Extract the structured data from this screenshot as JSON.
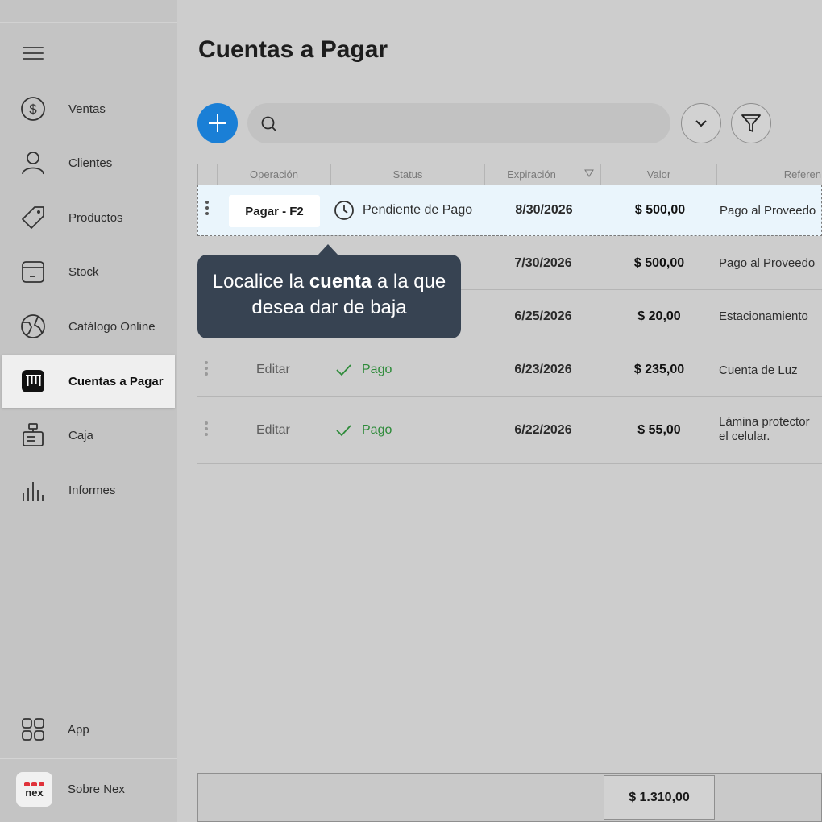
{
  "sidebar": {
    "items": [
      {
        "label": "Ventas",
        "icon": "dollar-icon"
      },
      {
        "label": "Clientes",
        "icon": "user-icon"
      },
      {
        "label": "Productos",
        "icon": "tag-icon"
      },
      {
        "label": "Stock",
        "icon": "box-icon"
      },
      {
        "label": "Catálogo Online",
        "icon": "globe-icon"
      },
      {
        "label": "Cuentas a Pagar",
        "icon": "bills-icon",
        "active": true
      },
      {
        "label": "Caja",
        "icon": "cash-register-icon"
      },
      {
        "label": "Informes",
        "icon": "bar-chart-icon"
      }
    ],
    "app_label": "App",
    "about_label": "Sobre Nex",
    "logo_text": "nex"
  },
  "header": {
    "title": "Cuentas a Pagar"
  },
  "toolbar": {
    "search_placeholder": ""
  },
  "table": {
    "columns": [
      "Operación",
      "Status",
      "Expiración",
      "Valor",
      "Referen"
    ],
    "rows": [
      {
        "operation": "Pagar - F2",
        "status": "Pendiente de Pago",
        "expiration": "8/30/2026",
        "value": "$ 500,00",
        "reference": "Pago al Proveedo",
        "selected": true
      },
      {
        "operation": "",
        "status": "",
        "expiration": "7/30/2026",
        "value": "$ 500,00",
        "reference": "Pago al Proveedo"
      },
      {
        "operation": "",
        "status": "",
        "expiration": "6/25/2026",
        "value": "$ 20,00",
        "reference": "Estacionamiento"
      },
      {
        "operation": "Editar",
        "status": "Pago",
        "expiration": "6/23/2026",
        "value": "$ 235,00",
        "reference": "Cuenta de Luz"
      },
      {
        "operation": "Editar",
        "status": "Pago",
        "expiration": "6/22/2026",
        "value": "$ 55,00",
        "reference_line1": "Lámina protector",
        "reference_line2": "el celular."
      }
    ],
    "total": "$ 1.310,00"
  },
  "tooltip": {
    "pre": "Localice la ",
    "bold": "cuenta",
    "post": " a la que desea dar de baja"
  },
  "colors": {
    "accent": "#1a7fd6",
    "paid": "#2e8b3a",
    "tooltip_bg": "#374352",
    "selected_row": "#eaf5fc"
  }
}
